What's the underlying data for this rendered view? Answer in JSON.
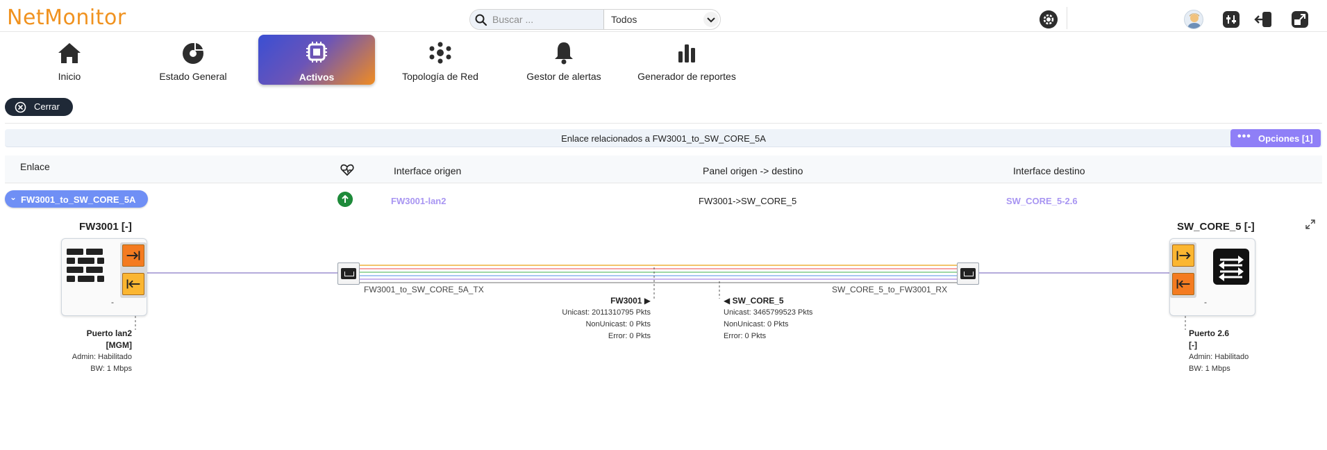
{
  "app": {
    "logo": "NetMonitor"
  },
  "search": {
    "placeholder": "Buscar ...",
    "filter_value": "Todos"
  },
  "nav": [
    {
      "label": "Inicio",
      "icon": "home-icon"
    },
    {
      "label": "Estado General",
      "icon": "pie-chart-icon"
    },
    {
      "label": "Activos",
      "icon": "chip-icon",
      "active": true
    },
    {
      "label": "Topología de Red",
      "icon": "network-icon"
    },
    {
      "label": "Gestor de alertas",
      "icon": "bell-icon"
    },
    {
      "label": "Generador de reportes",
      "icon": "bar-chart-icon"
    }
  ],
  "close_label": "Cerrar",
  "panel": {
    "title": "Enlace relacionados a FW3001_to_SW_CORE_5A",
    "options_label": "Opciones [1]"
  },
  "table": {
    "headers": {
      "enlace": "Enlace",
      "origen": "Interface origen",
      "panel": "Panel origen -> destino",
      "destino": "Interface destino"
    },
    "row": {
      "link": "FW3001_to_SW_CORE_5A",
      "status": "up",
      "origen": "FW3001-lan2",
      "panel": "FW3001->SW_CORE_5",
      "destino": "SW_CORE_5-2.6"
    }
  },
  "diagram": {
    "left_device": {
      "title": "FW3001 [-]",
      "dash": "-",
      "port_name": "Puerto lan2",
      "port_tag": "[MGM]",
      "admin": "Admin: Habilitado",
      "bw": "BW: 1 Mbps"
    },
    "right_device": {
      "title": "SW_CORE_5 [-]",
      "dash": "-",
      "port_name": "Puerto 2.6",
      "port_tag": "[-]",
      "admin": "Admin: Habilitado",
      "bw": "BW: 1 Mbps"
    },
    "tx_label": "FW3001_to_SW_CORE_5A_TX",
    "rx_label": "SW_CORE_5_to_FW3001_RX",
    "left_stats": {
      "title": "FW3001 ▶",
      "unicast": "Unicast: 2011310795 Pkts",
      "nonunicast": "NonUnicast: 0 Pkts",
      "error": "Error: 0 Pkts"
    },
    "right_stats": {
      "title": "◀ SW_CORE_5",
      "unicast": "Unicast: 3465799523 Pkts",
      "nonunicast": "NonUnicast: 0 Pkts",
      "error": "Error: 0 Pkts"
    },
    "cable_colors": [
      "#f2c46b",
      "#f6a2a2",
      "#9fd8a6",
      "#a8c6f2",
      "#c9b4ef",
      "#b8b8b8"
    ]
  },
  "colors": {
    "accent": "#8f7ff7",
    "logo": "#f0921f",
    "status_up": "#1e8a3a",
    "link_text": "#a895f2"
  }
}
